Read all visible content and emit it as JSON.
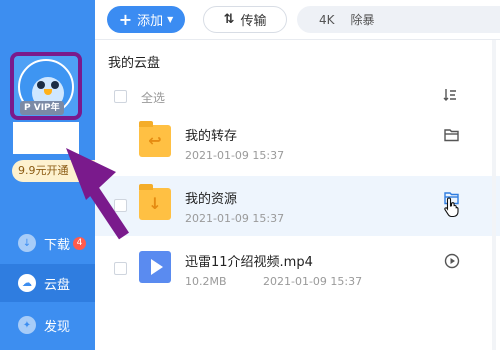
{
  "sidebar": {
    "vip_label": "P VIP年",
    "promo_text": "9.9元开通",
    "nav": [
      {
        "label": "下载",
        "badge": "4",
        "icon": "download-icon"
      },
      {
        "label": "云盘",
        "icon": "cloud-icon"
      },
      {
        "label": "发现",
        "icon": "compass-icon"
      }
    ]
  },
  "toolbar": {
    "add_label": "添加",
    "transfer_label": "传输",
    "ad_items": [
      "4K",
      "除暴"
    ]
  },
  "breadcrumb": "我的云盘",
  "list": {
    "select_all_label": "全选",
    "rows": [
      {
        "name": "我的转存",
        "date": "2021-01-09 15:37",
        "size": "",
        "type": "folder",
        "action_icon": "folder-open-icon"
      },
      {
        "name": "我的资源",
        "date": "2021-01-09 15:37",
        "size": "",
        "type": "folder",
        "action_icon": "folder-open-icon"
      },
      {
        "name": "迅雷11介绍视频.mp4",
        "date": "2021-01-09 15:37",
        "size": "10.2MB",
        "type": "video",
        "action_icon": "play-circle-icon"
      }
    ]
  },
  "colors": {
    "sidebar": "#3d8ef0",
    "accent": "#3b8cf2",
    "annotation": "#7a1a8c",
    "folder": "#ffc043"
  }
}
